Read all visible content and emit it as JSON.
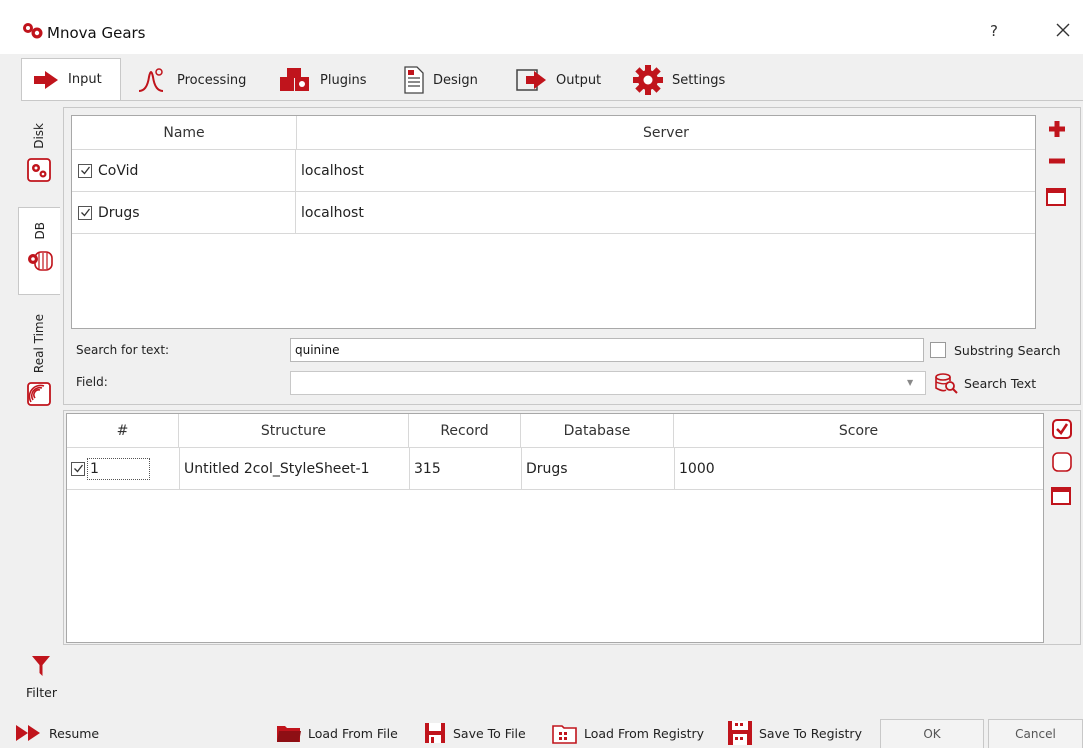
{
  "window": {
    "title": "Mnova Gears",
    "help_label": "?"
  },
  "tabs": [
    {
      "label": "Input",
      "icon": "arrow-right-icon"
    },
    {
      "label": "Processing",
      "icon": "peak-icon"
    },
    {
      "label": "Plugins",
      "icon": "blocks-icon"
    },
    {
      "label": "Design",
      "icon": "document-icon"
    },
    {
      "label": "Output",
      "icon": "export-icon"
    },
    {
      "label": "Settings",
      "icon": "gear-icon"
    }
  ],
  "side_tabs": [
    {
      "label": "Disk"
    },
    {
      "label": "DB"
    },
    {
      "label": "Real Time"
    }
  ],
  "db_table": {
    "headers": [
      "Name",
      "Server"
    ],
    "rows": [
      {
        "checked": true,
        "name": "CoVid",
        "server": "localhost"
      },
      {
        "checked": true,
        "name": "Drugs",
        "server": "localhost"
      }
    ]
  },
  "search": {
    "text_label": "Search for text:",
    "text_value": "quinine",
    "substring_label": "Substring Search",
    "field_label": "Field:",
    "field_value": "",
    "search_button": "Search Text"
  },
  "results": {
    "headers": [
      "#",
      "Structure",
      "Record",
      "Database",
      "Score"
    ],
    "rows": [
      {
        "checked": true,
        "num": "1",
        "structure": "Untitled 2col_StyleSheet-1",
        "record": "315",
        "database": "Drugs",
        "score": "1000"
      }
    ]
  },
  "filter_label": "Filter",
  "bottom": {
    "resume": "Resume",
    "load_file": "Load From File",
    "save_file": "Save To File",
    "load_registry": "Load From Registry",
    "save_registry": "Save To Registry",
    "ok": "OK",
    "cancel": "Cancel"
  },
  "colors": {
    "accent": "#c0141c"
  }
}
